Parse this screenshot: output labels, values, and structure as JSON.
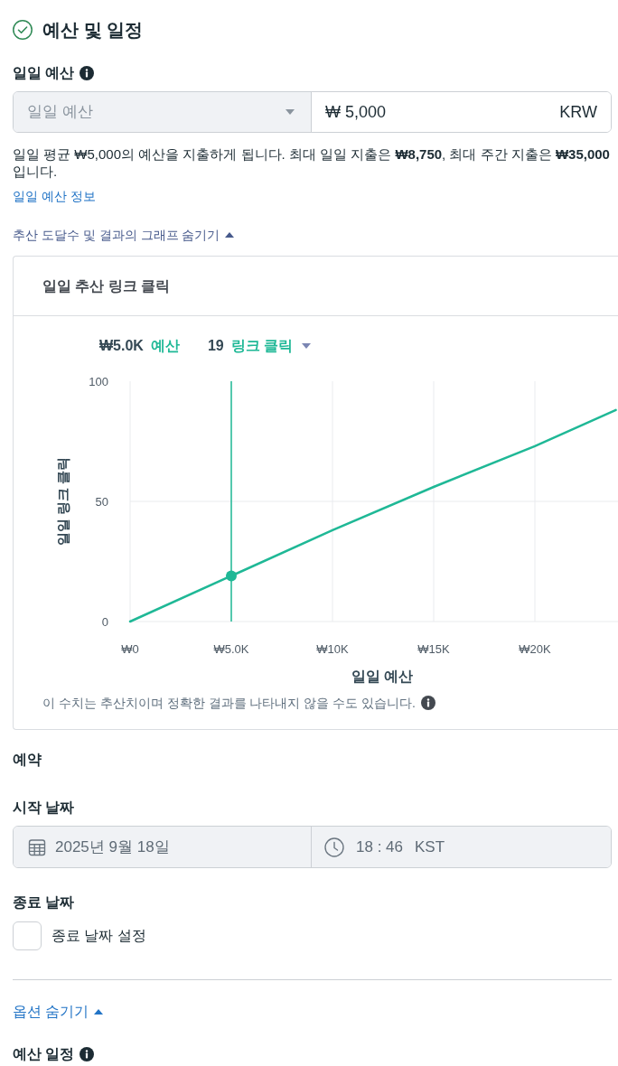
{
  "section": {
    "title": "예산 및 일정",
    "complete": true
  },
  "daily_budget": {
    "label": "일일 예산",
    "budget_type": {
      "value": "일일 예산",
      "disabled": true
    },
    "amount": {
      "value": "₩ 5,000",
      "currency": "KRW"
    },
    "description": "일일 평균 ₩5,000의 예산을 지출하게 됩니다. 최대 일일 지출은 **₩8,750**, 최대 주간 지출은 **₩35,000**입니다.",
    "info_link": "일일 예산 정보",
    "graph_toggle": {
      "label": "추산 도달수 및 결과의 그래프 숨기기",
      "expanded": true
    }
  },
  "estimate_card": {
    "title": "일일 추산 링크 클릭",
    "summary": [
      {
        "value": "₩5.0K",
        "label": "예산",
        "dropdown": false
      },
      {
        "value": "19",
        "label": "링크 클릭",
        "dropdown": true
      }
    ],
    "chart_data": {
      "type": "line",
      "xlabel": "일일 예산",
      "ylabel": "일일 링크 클릭",
      "x": [
        0,
        5000,
        10000,
        15000,
        20000,
        24000
      ],
      "series": [
        {
          "color": "#1fb896",
          "values": [
            0,
            19,
            38,
            56,
            73,
            88
          ]
        }
      ],
      "xlim": [
        0,
        24000
      ],
      "ylim": [
        0,
        100
      ],
      "xticks": [
        {
          "value": 0,
          "label": "₩0"
        },
        {
          "value": 5000,
          "label": "₩5.0K"
        },
        {
          "value": 10000,
          "label": "₩10K"
        },
        {
          "value": 15000,
          "label": "₩15K"
        },
        {
          "value": 20000,
          "label": "₩20K"
        }
      ],
      "yticks": [
        0,
        50,
        100
      ],
      "grid": true,
      "ref_lines": [
        {
          "axis": "x",
          "value": 5000
        }
      ]
    },
    "disclaimer": "이 수치는 추산치이며 정확한 결과를 나타내지 않을 수도 있습니다."
  },
  "schedule": {
    "title": "예약",
    "start_date": {
      "label": "시작 날짜",
      "date": {
        "value": "2025년 9월 18일",
        "disabled": true
      },
      "time": {
        "value": "18 : 46",
        "timezone": "KST",
        "disabled": true
      }
    },
    "end_date": {
      "label": "종료 날짜",
      "checkbox": {
        "label": "종료 날짜 설정",
        "checked": false
      }
    }
  },
  "options_toggle": {
    "label": "옵션 숨기기",
    "expanded": true
  },
  "budget_schedule": {
    "label": "예산 일정"
  }
}
